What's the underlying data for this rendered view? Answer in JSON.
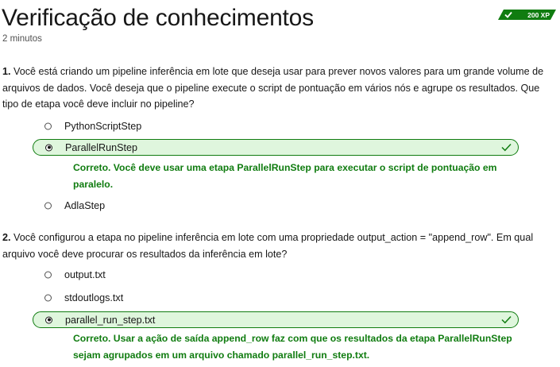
{
  "header": {
    "title": "Verificação de conhecimentos",
    "duration": "2 minutos",
    "xp": "200 XP"
  },
  "questions": [
    {
      "number": "1.",
      "text": "Você está criando um pipeline inferência em lote que deseja usar para prever novos valores para um grande volume de arquivos de dados. Você deseja que o pipeline execute o script de pontuação em vários nós e agrupe os resultados. Que tipo de etapa você deve incluir no pipeline?",
      "options": [
        {
          "label": "PythonScriptStep",
          "selected": false
        },
        {
          "label": "ParallelRunStep",
          "selected": true
        },
        {
          "label": "AdlaStep",
          "selected": false
        }
      ],
      "feedback": "Correto. Você deve usar uma etapa ParallelRunStep para executar o script de pontuação em paralelo."
    },
    {
      "number": "2.",
      "text": "Você configurou a etapa no pipeline inferência em lote com uma propriedade output_action = \"append_row\". Em qual arquivo você deve procurar os resultados da inferência em lote?",
      "options": [
        {
          "label": "output.txt",
          "selected": false
        },
        {
          "label": "stdoutlogs.txt",
          "selected": false
        },
        {
          "label": "parallel_run_step.txt",
          "selected": true
        }
      ],
      "feedback": "Correto. Usar a ação de saída append_row faz com que os resultados da etapa ParallelRunStep sejam agrupados em um arquivo chamado parallel_run_step.txt."
    }
  ],
  "colors": {
    "accent": "#107c10",
    "selected_bg": "#dff6dd"
  },
  "icons": {
    "badge": "check-icon",
    "correct": "checkmark-icon"
  }
}
